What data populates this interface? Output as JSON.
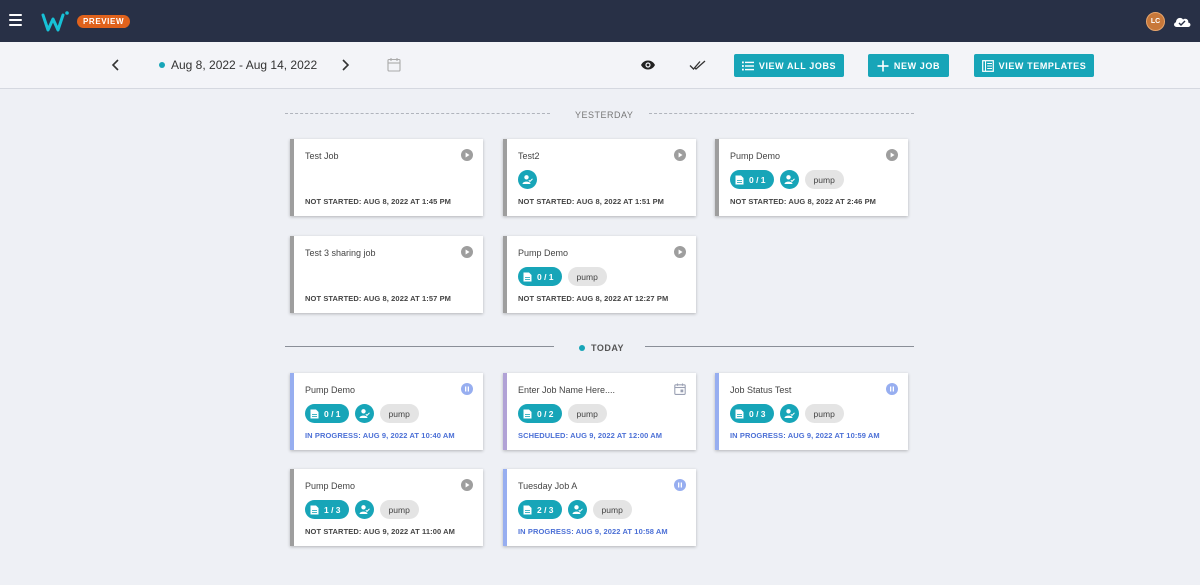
{
  "app": {
    "badge": "PREVIEW",
    "user_initials": "LC"
  },
  "toolbar": {
    "date_range": "Aug 8, 2022 - Aug 14, 2022",
    "view_all_label": "VIEW ALL JOBS",
    "new_job_label": "NEW JOB",
    "view_templates_label": "VIEW TEMPLATES"
  },
  "sections": {
    "yesterday": "YESTERDAY",
    "today": "TODAY"
  },
  "jobs": {
    "test_job": {
      "title": "Test Job",
      "status": "NOT STARTED: AUG 8, 2022 AT 1:45 PM"
    },
    "test2": {
      "title": "Test2",
      "status": "NOT STARTED: AUG 8, 2022 AT 1:51 PM"
    },
    "pump_demo_1": {
      "title": "Pump Demo",
      "forms": "0 / 1",
      "tag": "pump",
      "status": "NOT STARTED: AUG 8, 2022 AT 2:46 PM"
    },
    "test3": {
      "title": "Test 3 sharing job",
      "status": "NOT STARTED: AUG 8, 2022 AT 1:57 PM"
    },
    "pump_demo_2": {
      "title": "Pump Demo",
      "forms": "0 / 1",
      "tag": "pump",
      "status": "NOT STARTED: AUG 8, 2022 AT 12:27 PM"
    },
    "pump_demo_3": {
      "title": "Pump Demo",
      "forms": "0 / 1",
      "tag": "pump",
      "status": "IN PROGRESS: AUG 9, 2022 AT 10:40 AM"
    },
    "enter_job": {
      "title": "Enter Job Name Here....",
      "forms": "0 / 2",
      "tag": "pump",
      "status": "SCHEDULED: AUG 9, 2022 AT 12:00 AM"
    },
    "job_status_test": {
      "title": "Job Status Test",
      "forms": "0 / 3",
      "tag": "pump",
      "status": "IN PROGRESS: AUG 9, 2022 AT 10:59 AM"
    },
    "pump_demo_4": {
      "title": "Pump Demo",
      "forms": "1 / 3",
      "tag": "pump",
      "status": "NOT STARTED: AUG 9, 2022 AT 11:00 AM"
    },
    "tuesday_job": {
      "title": "Tuesday Job A",
      "forms": "2 / 3",
      "tag": "pump",
      "status": "IN PROGRESS: AUG 9, 2022 AT 10:58 AM"
    }
  },
  "colors": {
    "topbar": "#283046",
    "accent": "#17a5b8",
    "badge": "#e0621c",
    "in_progress": "#4c70d6",
    "not_started_border": "#9e9e9e"
  },
  "icons": {
    "menu": "menu-icon",
    "cloud": "cloud-icon",
    "calendar": "calendar-icon",
    "eye": "eye-icon",
    "checks": "double-check-icon",
    "play": "play-circle-icon",
    "pause": "pause-circle-icon",
    "event": "event-icon"
  }
}
